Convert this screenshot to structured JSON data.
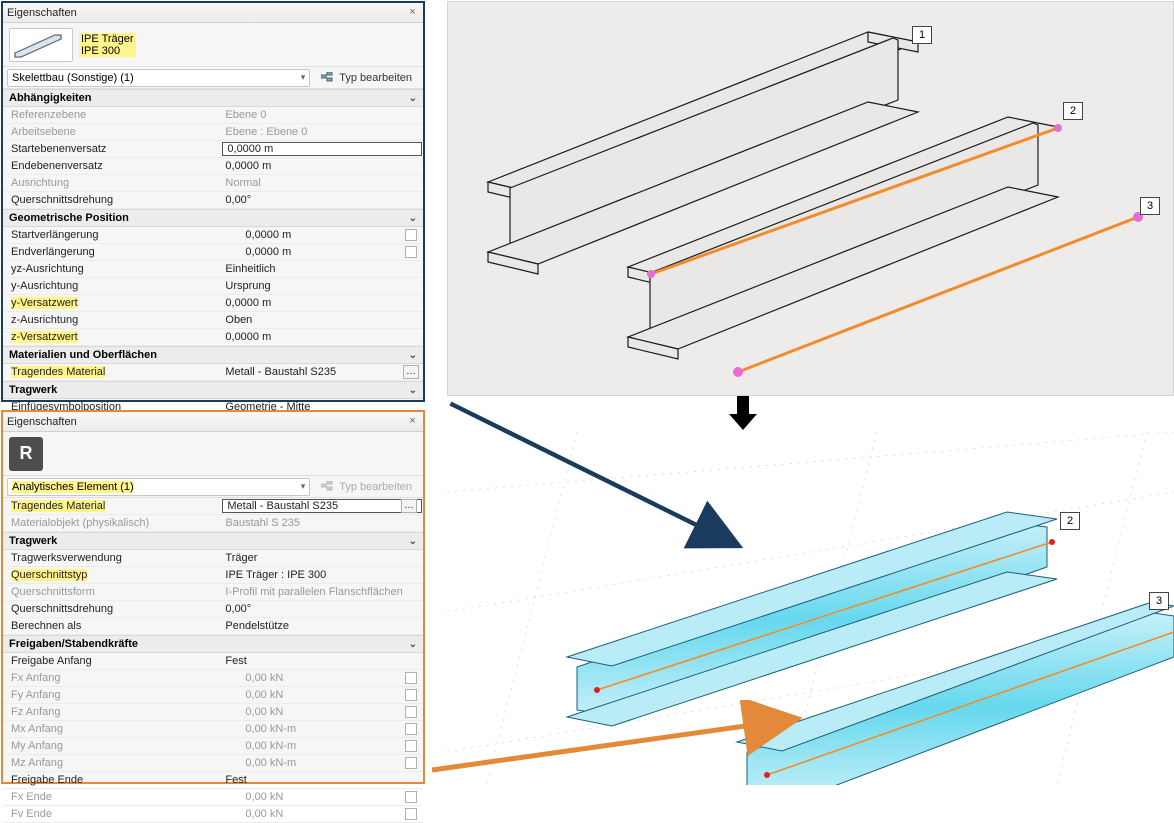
{
  "panel_title": "Eigenschaften",
  "close_label": "×",
  "edit_type_label": "Typ bearbeiten",
  "top": {
    "preview_line1": "IPE Träger",
    "preview_line2": "IPE 300",
    "selector": "Skelettbau (Sonstige) (1)",
    "groups": [
      {
        "title": "Abhängigkeiten",
        "rows": [
          {
            "k": "Referenzebene",
            "v": "Ebene 0",
            "dim": true
          },
          {
            "k": "Arbeitsebene",
            "v": "Ebene : Ebene 0",
            "dim": true
          },
          {
            "k": "Startebenenversatz",
            "v": "0,0000 m",
            "input": true
          },
          {
            "k": "Endebenenversatz",
            "v": "0,0000 m"
          },
          {
            "k": "Ausrichtung",
            "v": "Normal",
            "dim": true
          },
          {
            "k": "Querschnittsdrehung",
            "v": "0,00°"
          }
        ]
      },
      {
        "title": "Geometrische Position",
        "rows": [
          {
            "k": "Startverlängerung",
            "v": "0,0000 m",
            "cb": true
          },
          {
            "k": "Endverlängerung",
            "v": "0,0000 m",
            "cb": true
          },
          {
            "k": "yz-Ausrichtung",
            "v": "Einheitlich"
          },
          {
            "k": "y-Ausrichtung",
            "v": "Ursprung"
          },
          {
            "k": "y-Versatzwert",
            "v": "0,0000 m",
            "hl": true
          },
          {
            "k": "z-Ausrichtung",
            "v": "Oben"
          },
          {
            "k": "z-Versatzwert",
            "v": "0,0000 m",
            "hl": true
          }
        ]
      },
      {
        "title": "Materialien und Oberflächen",
        "rows": [
          {
            "k": "Tragendes Material",
            "v": "Metall - Baustahl S235",
            "hl": true,
            "dots": true
          }
        ]
      },
      {
        "title": "Tragwerk",
        "rows": [
          {
            "k": "Einfügesvmbolposition",
            "v": "Geometrie - Mitte"
          }
        ]
      }
    ]
  },
  "bot": {
    "r_logo": "R",
    "selector": "Analytisches Element (1)",
    "groups": [
      {
        "title": "",
        "rows": [
          {
            "k": "Tragendes Material",
            "v": "Metall - Baustahl S235",
            "hl": true,
            "input": true,
            "dots": true
          },
          {
            "k": "Materialobjekt (physikalisch)",
            "v": "Baustahl S 235",
            "dim": true
          }
        ]
      },
      {
        "title": "Tragwerk",
        "rows": [
          {
            "k": "Tragwerksverwendung",
            "v": "Träger"
          },
          {
            "k": "Querschnittstyp",
            "v": "IPE Träger : IPE 300",
            "hl": true
          },
          {
            "k": "Querschnittsform",
            "v": "I-Profil mit parallelen Flanschflächen",
            "dim": true
          },
          {
            "k": "Querschnittsdrehung",
            "v": "0,00°"
          },
          {
            "k": "Berechnen als",
            "v": "Pendelstütze"
          }
        ]
      },
      {
        "title": "Freigaben/Stabendkräfte",
        "rows": [
          {
            "k": "Freigabe Anfang",
            "v": "Fest"
          },
          {
            "k": "Fx Anfang",
            "v": "0,00 kN",
            "cb": true,
            "dim": true
          },
          {
            "k": "Fy Anfang",
            "v": "0,00 kN",
            "cb": true,
            "dim": true
          },
          {
            "k": "Fz Anfang",
            "v": "0,00 kN",
            "cb": true,
            "dim": true
          },
          {
            "k": "Mx Anfang",
            "v": "0,00 kN-m",
            "cb": true,
            "dim": true
          },
          {
            "k": "My Anfang",
            "v": "0,00 kN-m",
            "cb": true,
            "dim": true
          },
          {
            "k": "Mz Anfang",
            "v": "0,00 kN-m",
            "cb": true,
            "dim": true
          },
          {
            "k": "Freigabe Ende",
            "v": "Fest"
          },
          {
            "k": "Fx Ende",
            "v": "0,00 kN",
            "cb": true,
            "dim": true
          },
          {
            "k": "Fv Ende",
            "v": "0,00 kN",
            "cb": true,
            "dim": true
          }
        ]
      }
    ]
  },
  "view3d": {
    "labels": {
      "a": "1",
      "b": "2",
      "c": "3"
    },
    "labels2": {
      "a": "2",
      "b": "3"
    }
  }
}
